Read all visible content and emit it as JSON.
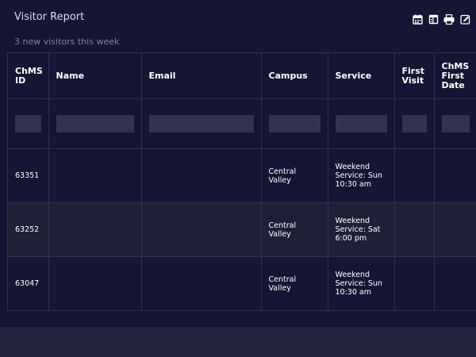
{
  "header": {
    "title": "Visitor Report",
    "subtitle": "3 new visitors this week"
  },
  "toolbar": {
    "icons": [
      "calendar-icon",
      "columns-icon",
      "print-icon",
      "edit-icon"
    ]
  },
  "table": {
    "columns": [
      "ChMS ID",
      "Name",
      "Email",
      "Campus",
      "Service",
      "First Visit",
      "ChMS First Date"
    ],
    "filters": [
      "",
      "",
      "",
      "",
      "",
      "",
      ""
    ],
    "rows": [
      {
        "id": "63351",
        "name": "",
        "email": "",
        "campus": "Central Valley",
        "service": "Weekend Service: Sun 10:30 am",
        "first_visit": "",
        "chms_first_date": ""
      },
      {
        "id": "63252",
        "name": "",
        "email": "",
        "campus": "Central Valley",
        "service": "Weekend Service: Sat 6:00 pm",
        "first_visit": "",
        "chms_first_date": ""
      },
      {
        "id": "63047",
        "name": "",
        "email": "",
        "campus": "Central Valley",
        "service": "Weekend Service: Sun 10:30 am",
        "first_visit": "",
        "chms_first_date": ""
      }
    ]
  }
}
